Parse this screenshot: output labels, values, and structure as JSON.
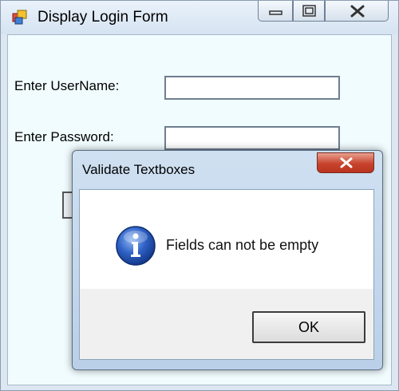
{
  "window": {
    "title": "Display Login Form"
  },
  "form": {
    "username_label": "Enter UserName:",
    "username_value": "",
    "password_label": "Enter Password:",
    "password_value": ""
  },
  "dialog": {
    "title": "Validate Textboxes",
    "message": "Fields can not be empty",
    "ok_label": "OK",
    "icon": "info-icon"
  }
}
